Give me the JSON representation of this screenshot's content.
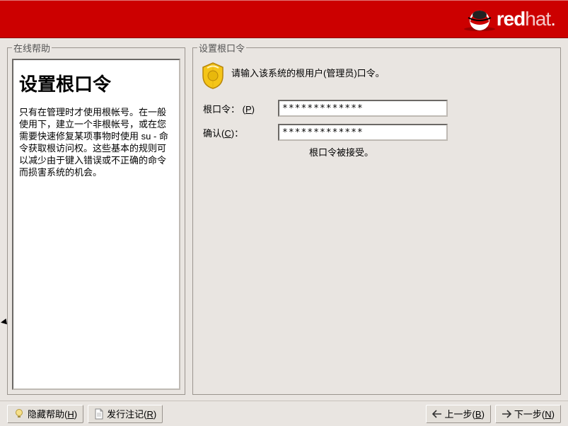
{
  "brand": {
    "bold": "red",
    "light": "hat",
    "dot": "."
  },
  "help": {
    "legend": "在线帮助",
    "title": "设置根口令",
    "body": "只有在管理时才使用根帐号。在一般使用下，建立一个非根帐号，或在您需要快速修复某项事物时使用 su - 命令获取根访问权。这些基本的规则可以减少由于键入错误或不正确的命令而损害系统的机会。"
  },
  "main": {
    "legend": "设置根口令",
    "intro": "请输入该系统的根用户(管理员)口令。",
    "label1_pre": "根口令：",
    "label1_mn": "P",
    "label2_pre": "确认",
    "label2_mn": "C",
    "label2_post": "：",
    "pw_value": "*************",
    "status": "根口令被接受。"
  },
  "footer": {
    "hide_help": "隐藏帮助",
    "hide_help_mn": "H",
    "release_notes": "发行注记",
    "release_notes_mn": "R",
    "back": "上一步",
    "back_mn": "B",
    "next": "下一步",
    "next_mn": "N"
  }
}
